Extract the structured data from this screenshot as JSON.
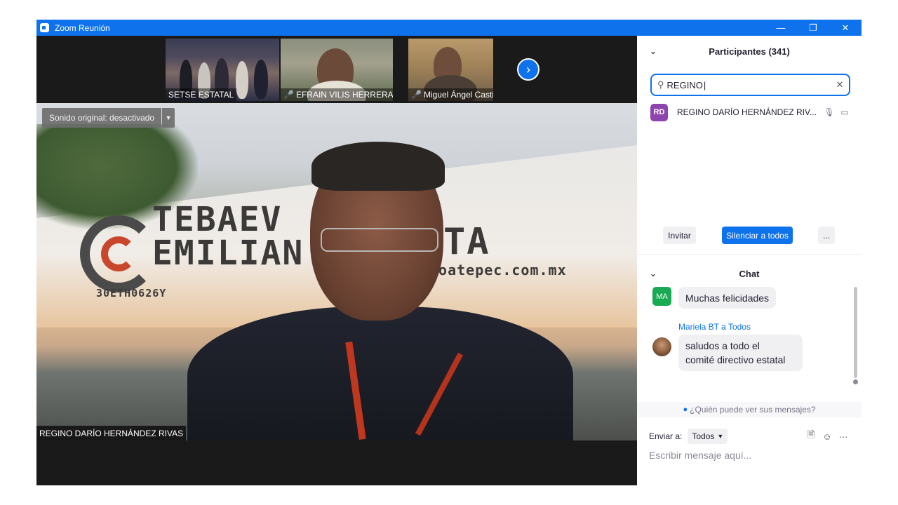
{
  "window": {
    "title": "Zoom Reunión",
    "controls": [
      "minimize-icon",
      "restore-icon",
      "close-icon"
    ]
  },
  "thumbnails": [
    {
      "name": "SETSE ESTATAL",
      "muted": false
    },
    {
      "name": "EFRAIN VILIS HERRERA",
      "muted": true
    },
    {
      "name": "Miguel Ángel Castillo...",
      "muted": true
    }
  ],
  "main_video": {
    "sound_button": "Sonido original: desactivado",
    "speaker_name": "REGINO DARÍO HERNÁNDEZ RIVAS",
    "wall_text": {
      "line1": "TEBAEV",
      "line2": "EMILIAN",
      "line3": "TA",
      "code": "30ETH0626Y",
      "web": "coatepec.com.mx"
    }
  },
  "participants": {
    "header": "Participantes (341)",
    "search_value": "REGINO",
    "list": [
      {
        "initials": "RD",
        "name": "REGINO DARÍO HERNÁNDEZ RIV...",
        "avatar_color": "#8e44ad"
      }
    ],
    "invite_label": "Invitar",
    "mute_all_label": "Silenciar a todos",
    "more_label": "..."
  },
  "chat": {
    "header": "Chat",
    "messages": [
      {
        "avatar": "MA",
        "text": "Muchas felicidades"
      },
      {
        "sender": "Mariela BT",
        "recipient_prefix": "a",
        "recipient": "Todos",
        "text_line1": "saludos a todo el",
        "text_line2": "comité directivo estatal"
      }
    ],
    "who_can_see": "¿Quién puede ver sus mensajes?",
    "send_to_label": "Enviar a:",
    "send_to_value": "Todos",
    "input_placeholder": "Escribir mensaje aquí..."
  },
  "colors": {
    "accent": "#0e72ed",
    "mute_red": "#e02828",
    "avatar_ma": "#1aaa55"
  }
}
